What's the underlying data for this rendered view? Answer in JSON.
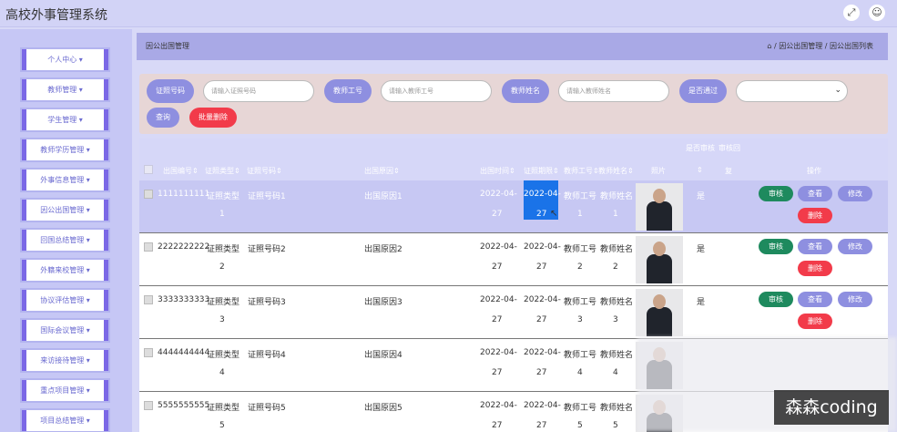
{
  "app": {
    "title": "高校外事管理系统"
  },
  "icons": {
    "fullscreen": "fullscreen-icon",
    "user": "user-icon",
    "home": "home-icon"
  },
  "sidebar": {
    "items": [
      {
        "label": "个人中心"
      },
      {
        "label": "教师管理"
      },
      {
        "label": "学生管理"
      },
      {
        "label": "教师学历管理"
      },
      {
        "label": "外事信息管理"
      },
      {
        "label": "因公出国管理"
      },
      {
        "label": "回国总结管理"
      },
      {
        "label": "外籍来校管理"
      },
      {
        "label": "协议评估管理"
      },
      {
        "label": "国际会议管理"
      },
      {
        "label": "来访接待管理"
      },
      {
        "label": "重点项目管理"
      },
      {
        "label": "项目总结管理"
      }
    ]
  },
  "breadcrumb": {
    "page_title": "因公出国管理",
    "path": "/ 因公出国管理 / 因公出国列表"
  },
  "filter": {
    "cert_label": "证照号码",
    "cert_placeholder": "请输入证照号码",
    "teacher_no_label": "教师工号",
    "teacher_no_placeholder": "请输入教师工号",
    "teacher_name_label": "教师姓名",
    "teacher_name_placeholder": "请输入教师姓名",
    "approved_label": "是否通过",
    "search_label": "查询",
    "batch_delete_label": "批量删除"
  },
  "table": {
    "header_top": [
      "是否审核",
      "审核回"
    ],
    "headers": [
      "出国编号",
      "证照类型",
      "证照号码",
      "出国原因",
      "出国时间",
      "证照期限",
      "教师工号",
      "教师姓名",
      "照片",
      "",
      "复",
      "操作"
    ],
    "rows": [
      {
        "no": "1111111111",
        "type": [
          "证照类型",
          "1"
        ],
        "cert": "证照号码1",
        "reason": "出国原因1",
        "date1": [
          "2022-04-",
          "27"
        ],
        "date2": [
          "2022-04-",
          "27"
        ],
        "tno": [
          "教师工号",
          "1"
        ],
        "tname": [
          "教师姓名",
          "1"
        ],
        "review": "是"
      },
      {
        "no": "2222222222",
        "type": [
          "证照类型",
          "2"
        ],
        "cert": "证照号码2",
        "reason": "出国原因2",
        "date1": [
          "2022-04-",
          "27"
        ],
        "date2": [
          "2022-04-",
          "27"
        ],
        "tno": [
          "教师工号",
          "2"
        ],
        "tname": [
          "教师姓名",
          "2"
        ],
        "review": "是"
      },
      {
        "no": "3333333333",
        "type": [
          "证照类型",
          "3"
        ],
        "cert": "证照号码3",
        "reason": "出国原因3",
        "date1": [
          "2022-04-",
          "27"
        ],
        "date2": [
          "2022-04-",
          "27"
        ],
        "tno": [
          "教师工号",
          "3"
        ],
        "tname": [
          "教师姓名",
          "3"
        ],
        "review": "是"
      },
      {
        "no": "4444444444",
        "type": [
          "证照类型",
          "4"
        ],
        "cert": "证照号码4",
        "reason": "出国原因4",
        "date1": [
          "2022-04-",
          "27"
        ],
        "date2": [
          "2022-04-",
          "27"
        ],
        "tno": [
          "教师工号",
          "4"
        ],
        "tname": [
          "教师姓名",
          "4"
        ],
        "review": ""
      },
      {
        "no": "5555555555",
        "type": [
          "证照类型",
          "5"
        ],
        "cert": "证照号码5",
        "reason": "出国原因5",
        "date1": [
          "2022-04-",
          "27"
        ],
        "date2": [
          "2022-04-",
          "27"
        ],
        "tno": [
          "教师工号",
          "5"
        ],
        "tname": [
          "教师姓名",
          "5"
        ],
        "review": ""
      }
    ],
    "actions": {
      "review": "审核",
      "view": "查看",
      "edit": "修改",
      "delete": "删除"
    }
  },
  "colors": {
    "review_btn": "#1e8a5e",
    "view_btn": "#8e8fe0",
    "edit_btn": "#8e8fe0",
    "delete_btn": "#f23b4a"
  },
  "watermark": "森森coding"
}
